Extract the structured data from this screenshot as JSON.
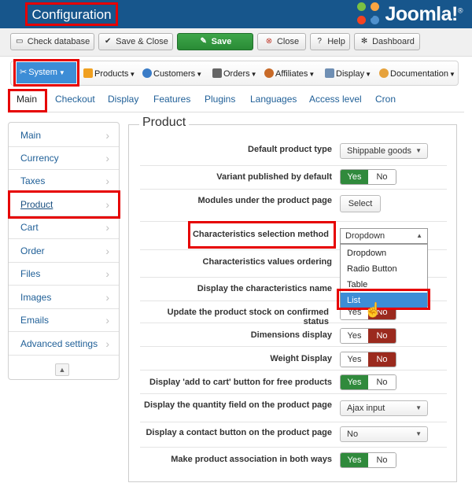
{
  "header": {
    "title": "Configuration",
    "brand": "Joomla!",
    "brand_sup": "®"
  },
  "toolbar": {
    "check_database": "Check database",
    "save_close": "Save & Close",
    "save": "Save",
    "close": "Close",
    "help": "Help",
    "dashboard": "Dashboard"
  },
  "menu": {
    "system": "System",
    "products": "Products",
    "customers": "Customers",
    "orders": "Orders",
    "affiliates": "Affiliates",
    "display": "Display",
    "documentation": "Documentation"
  },
  "tabs": [
    "Main",
    "Checkout",
    "Display",
    "Features",
    "Plugins",
    "Languages",
    "Access level",
    "Cron"
  ],
  "sidebar": {
    "items": [
      {
        "label": "Main"
      },
      {
        "label": "Currency"
      },
      {
        "label": "Taxes"
      },
      {
        "label": "Product"
      },
      {
        "label": "Cart"
      },
      {
        "label": "Order"
      },
      {
        "label": "Files"
      },
      {
        "label": "Images"
      },
      {
        "label": "Emails"
      },
      {
        "label": "Advanced settings"
      }
    ],
    "active": "Product"
  },
  "product": {
    "legend": "Product",
    "fields": {
      "default_type": {
        "label": "Default product type",
        "value": "Shippable goods"
      },
      "variant_published": {
        "label": "Variant published by default",
        "yes": "Yes",
        "no": "No",
        "state": "yes"
      },
      "modules_under": {
        "label": "Modules under the product page",
        "button": "Select"
      },
      "char_method": {
        "label": "Characteristics selection method",
        "value": "Dropdown"
      },
      "char_ordering": {
        "label": "Characteristics values ordering"
      },
      "display_char_name": {
        "label": "Display the characteristics name"
      },
      "update_stock": {
        "label": "Update the product stock on confirmed status",
        "yes": "Yes",
        "no": "No",
        "state": "no"
      },
      "dimensions_display": {
        "label": "Dimensions display",
        "yes": "Yes",
        "no": "No",
        "state": "no"
      },
      "weight_display": {
        "label": "Weight Display",
        "yes": "Yes",
        "no": "No",
        "state": "no"
      },
      "add_to_cart_free": {
        "label": "Display 'add to cart' button for free products",
        "yes": "Yes",
        "no": "No",
        "state": "yes"
      },
      "quantity_field": {
        "label": "Display the quantity field on the product page",
        "value": "Ajax input"
      },
      "contact_button": {
        "label": "Display a contact button on the product page",
        "value": "No"
      },
      "association_both": {
        "label": "Make product association in both ways",
        "yes": "Yes",
        "no": "No",
        "state": "yes"
      }
    },
    "char_method_options": [
      "Dropdown",
      "Radio Button",
      "Table",
      "List"
    ],
    "char_method_highlighted": "List"
  },
  "colors": {
    "header_bg": "#17568c",
    "accent_red": "#e60000",
    "link_blue": "#1f5f97",
    "yes_green": "#308a3c",
    "no_red": "#9b2a1e",
    "select_blue": "#3d8dd6"
  },
  "icons": {
    "check_database": "check-database-icon",
    "save_close": "check-icon",
    "save": "edit-icon",
    "close": "close-circle-icon",
    "help": "question-icon",
    "dashboard": "dashboard-icon"
  }
}
